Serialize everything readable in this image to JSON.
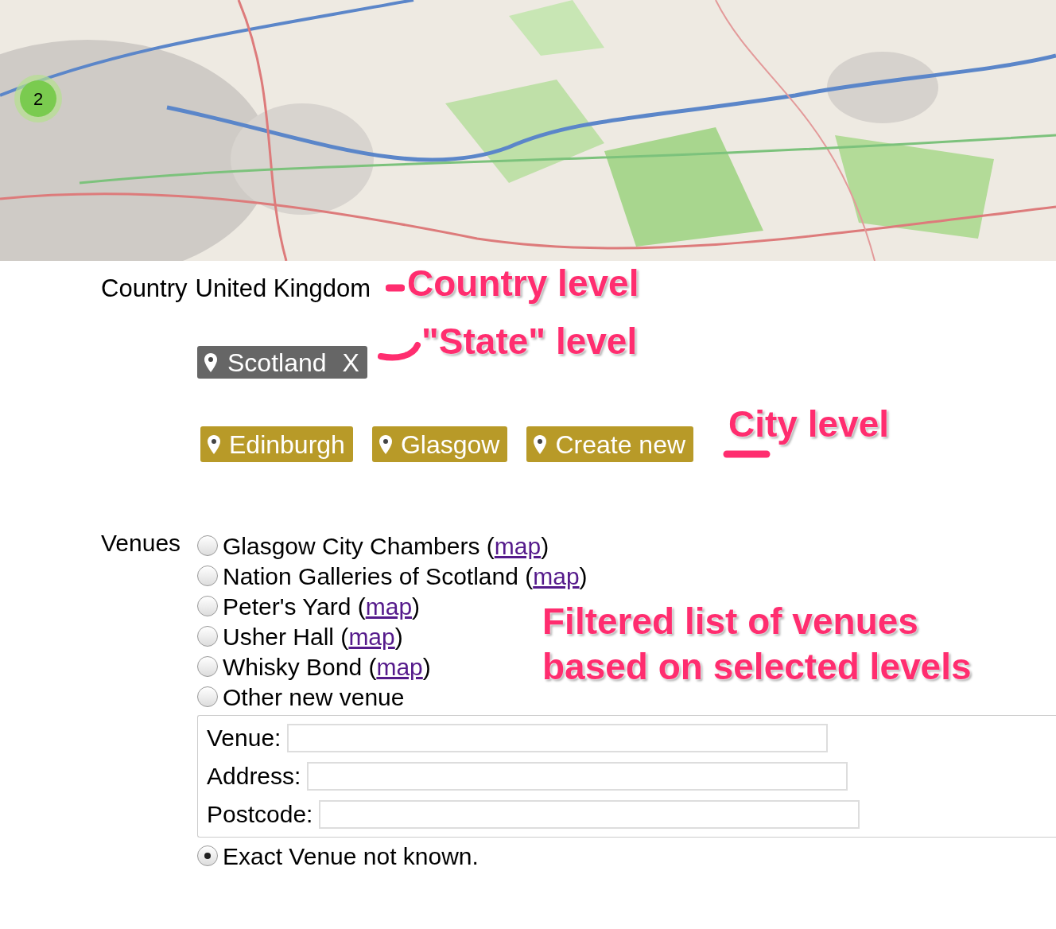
{
  "map": {
    "cluster": {
      "count": "2"
    }
  },
  "country": {
    "label": "Country",
    "value": "United Kingdom"
  },
  "state_tags": [
    {
      "label": "Scotland",
      "remove": "X"
    }
  ],
  "city_tags": [
    {
      "label": "Edinburgh"
    },
    {
      "label": "Glasgow"
    },
    {
      "label": "Create new"
    }
  ],
  "venues": {
    "label": "Venues",
    "options": [
      {
        "kind": "link",
        "name": "Glasgow City Chambers (",
        "link": "map",
        "after": ")",
        "selected": false
      },
      {
        "kind": "link",
        "name": "Nation Galleries of Scotland (",
        "link": "map",
        "after": ")",
        "selected": false
      },
      {
        "kind": "link",
        "name": "Peter's Yard (",
        "link": "map",
        "after": ")",
        "selected": false
      },
      {
        "kind": "link",
        "name": "Usher Hall (",
        "link": "map",
        "after": ")",
        "selected": false
      },
      {
        "kind": "link",
        "name": "Whisky Bond (",
        "link": "map",
        "after": ")",
        "selected": false
      },
      {
        "kind": "plain",
        "name": "Other new venue",
        "selected": false
      }
    ],
    "new_venue_fields": [
      {
        "label": "Venue:"
      },
      {
        "label": "Address:"
      },
      {
        "label": "Postcode:"
      }
    ],
    "unknown_option": {
      "label": "Exact Venue not known.",
      "selected": true
    }
  },
  "annotations": [
    {
      "text": "Country level"
    },
    {
      "text": "\"State\" level"
    },
    {
      "text": "City level"
    },
    {
      "text": "Filtered list of venues\nbased on selected levels"
    }
  ]
}
